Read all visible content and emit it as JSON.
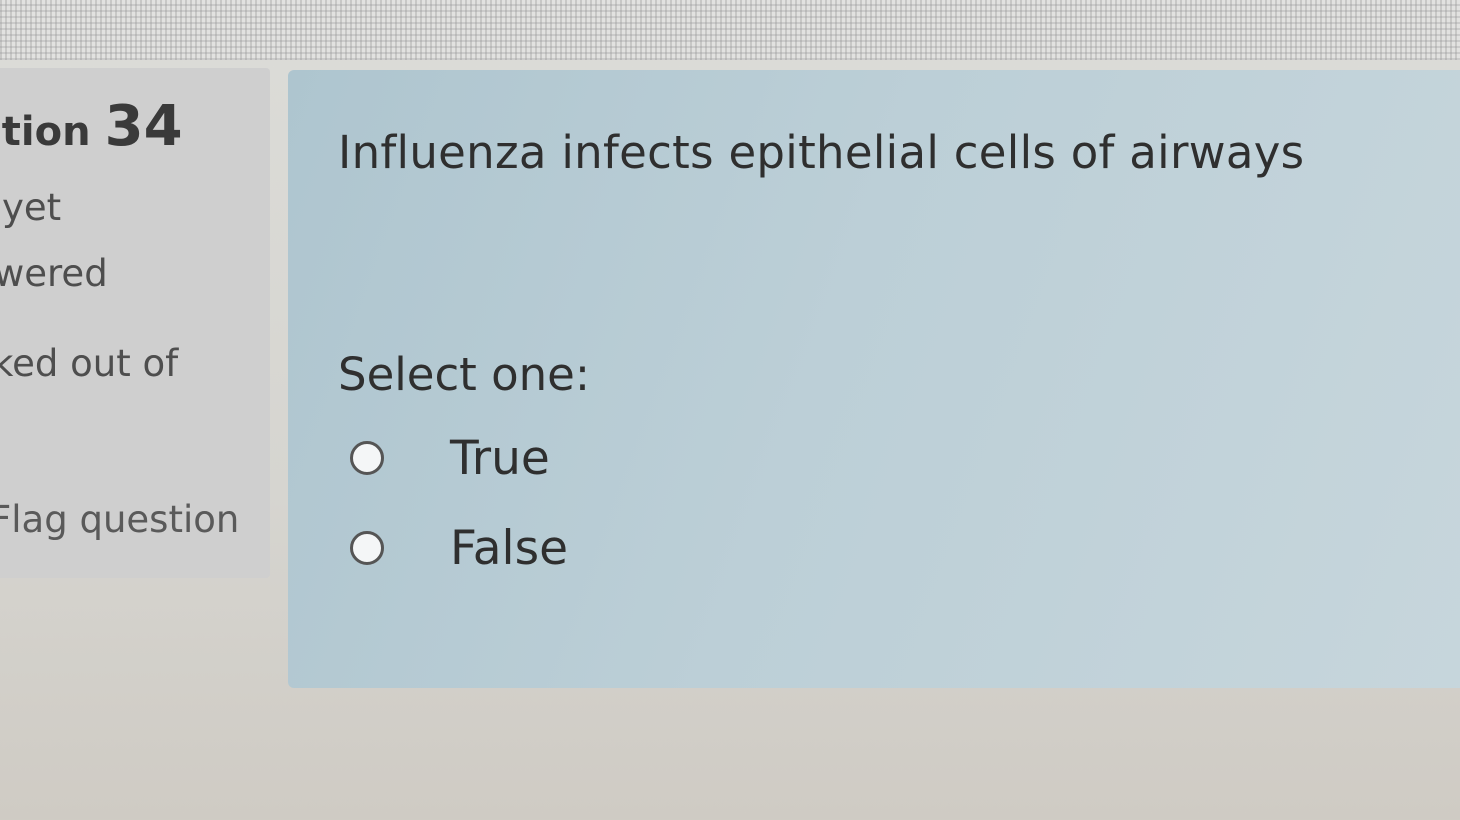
{
  "info": {
    "question_label": "stion",
    "question_number": "34",
    "state_line1": "yet",
    "state_line2": "wered",
    "grade_line1": "ked out of",
    "grade_line2": ")",
    "flag_label": "Flag question"
  },
  "question": {
    "text": "Influenza infects epithelial cells of airways",
    "prompt": "Select one:",
    "options": [
      {
        "label": "True",
        "selected": false
      },
      {
        "label": "False",
        "selected": false
      }
    ]
  }
}
